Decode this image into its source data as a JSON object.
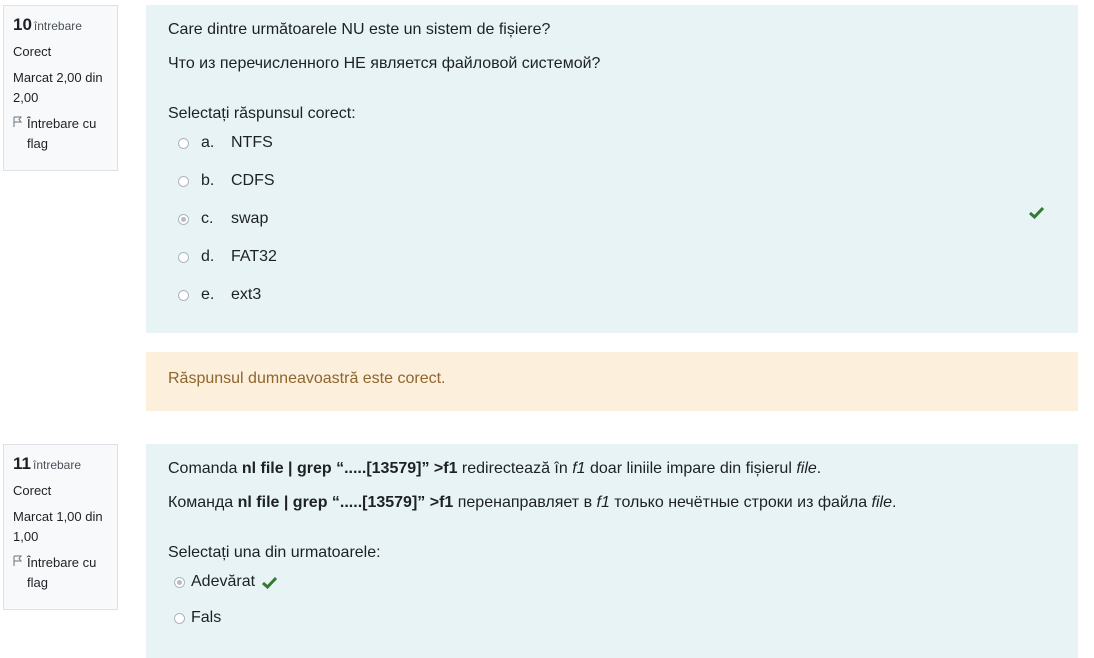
{
  "q10": {
    "number": "10",
    "label": "întrebare",
    "state": "Corect",
    "grade": "Marcat 2,00 din 2,00",
    "flag": "Întrebare cu flag",
    "text_ro": "Care dintre următoarele NU este un sistem de fișiere?",
    "text_ru": "Что из перечисленного НЕ является файловой системой?",
    "prompt": "Selectați răspunsul corect:",
    "options": [
      {
        "letter": "a.",
        "label": "NTFS",
        "selected": false
      },
      {
        "letter": "b.",
        "label": "CDFS",
        "selected": false
      },
      {
        "letter": "c.",
        "label": "swap",
        "selected": true
      },
      {
        "letter": "d.",
        "label": "FAT32",
        "selected": false
      },
      {
        "letter": "e.",
        "label": "ext3",
        "selected": false
      }
    ],
    "feedback": "Răspunsul dumneavoastră este corect."
  },
  "q11": {
    "number": "11",
    "label": "întrebare",
    "state": "Corect",
    "grade": "Marcat 1,00 din 1,00",
    "flag": "Întrebare cu flag",
    "ro": {
      "pre": "Comanda ",
      "cmd": "nl file | grep “.....[13579]” >f1",
      "mid": "  redirectează în ",
      "f1": "f1",
      "mid2": " doar liniile impare din fișierul ",
      "file": "file",
      "end": "."
    },
    "ru": {
      "pre": "Команда ",
      "cmd": "nl file | grep “.....[13579]” >f1",
      "mid": " перенаправляет в ",
      "f1": "f1",
      "mid2": " только нечётные строки из файла ",
      "file": "file",
      "end": "."
    },
    "prompt": "Selectați una din urmatoarele:",
    "options": [
      {
        "label": "Adevărat",
        "selected": true
      },
      {
        "label": "Fals",
        "selected": false
      }
    ]
  },
  "colors": {
    "correct": "#357a32",
    "question_bg": "#e7f3f5",
    "feedback_bg": "#fcefdc",
    "feedback_text": "#8e662e"
  },
  "icons": {
    "correct": "check-icon",
    "flag": "flag-icon"
  }
}
